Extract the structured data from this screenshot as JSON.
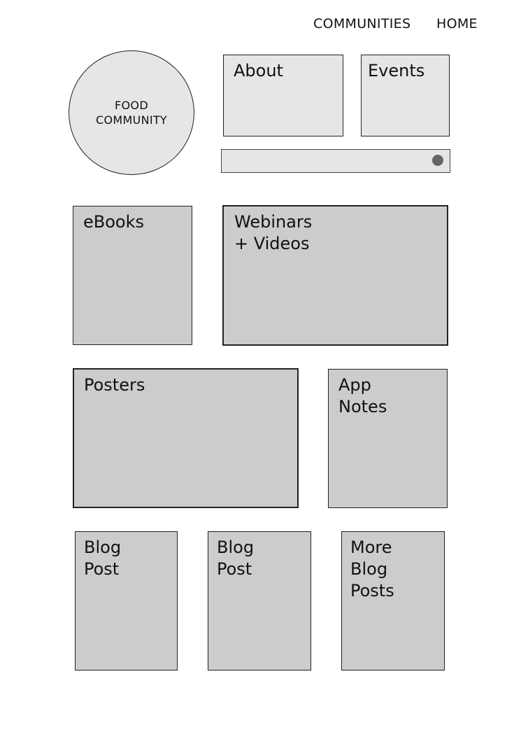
{
  "nav": {
    "communities": "COMMUNITIES",
    "home": "HOME"
  },
  "logo": {
    "line1": "FOOD",
    "line2": "COMMUNITY"
  },
  "tiles": {
    "about": [
      "About"
    ],
    "events": [
      "Events"
    ],
    "ebooks": [
      "eBooks"
    ],
    "webinars": [
      "Webinars",
      "+ Videos"
    ],
    "posters": [
      "Posters"
    ],
    "app_notes": [
      "App",
      "Notes"
    ],
    "blog_post_1": [
      "Blog",
      "Post"
    ],
    "blog_post_2": [
      "Blog",
      "Post"
    ],
    "more_blog_posts": [
      "More",
      "Blog",
      "Posts"
    ]
  },
  "search": {
    "icon": "search-dot-icon"
  },
  "colors": {
    "tile_fill": "#cccccc",
    "light_fill": "#e6e6e6",
    "border": "#222222",
    "dot": "#666666"
  }
}
